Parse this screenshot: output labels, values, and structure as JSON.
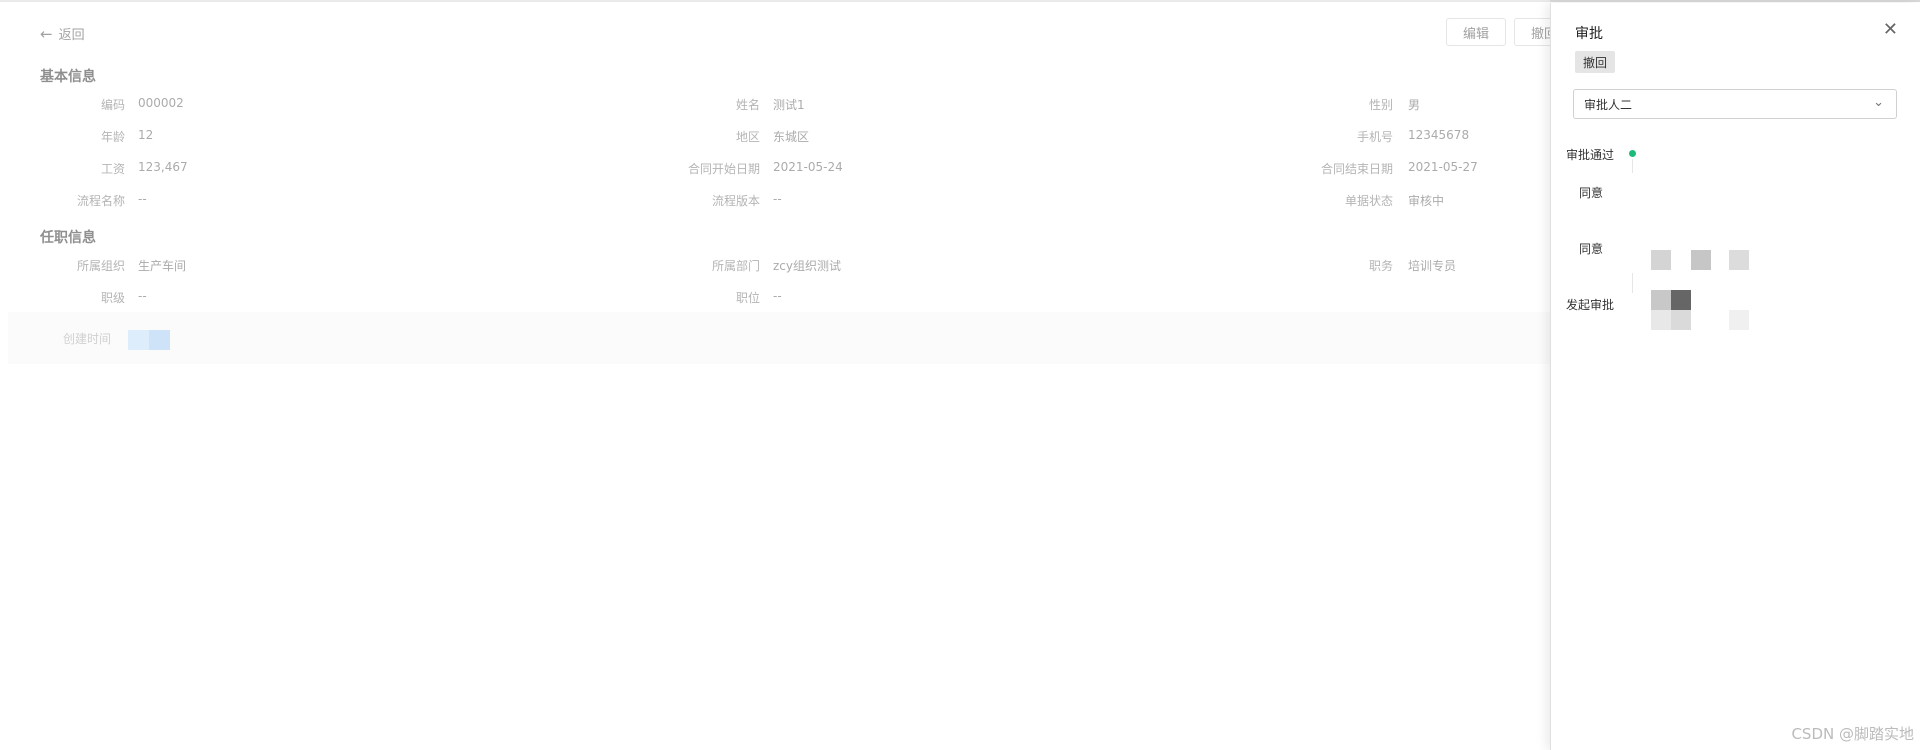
{
  "header": {
    "back_label": "返回",
    "edit_label": "编辑",
    "revoke_label": "撤回"
  },
  "basic_info": {
    "title": "基本信息",
    "fields": [
      {
        "label": "编码",
        "value": "000002"
      },
      {
        "label": "姓名",
        "value": "测试1"
      },
      {
        "label": "性别",
        "value": "男"
      },
      {
        "label": "年龄",
        "value": "12"
      },
      {
        "label": "地区",
        "value": "东城区"
      },
      {
        "label": "手机号",
        "value": "12345678"
      },
      {
        "label": "工资",
        "value": "123,467"
      },
      {
        "label": "合同开始日期",
        "value": "2021-05-24"
      },
      {
        "label": "合同结束日期",
        "value": "2021-05-27"
      },
      {
        "label": "流程名称",
        "value": "--"
      },
      {
        "label": "流程版本",
        "value": "--"
      },
      {
        "label": "单据状态",
        "value": "审核中"
      }
    ]
  },
  "job_info": {
    "title": "任职信息",
    "fields": [
      {
        "label": "所属组织",
        "value": "生产车间"
      },
      {
        "label": "所属部门",
        "value": "zcy组织测试"
      },
      {
        "label": "职务",
        "value": "培训专员"
      },
      {
        "label": "职级",
        "value": "--"
      },
      {
        "label": "职位",
        "value": "--"
      }
    ]
  },
  "created": {
    "label": "创建时间"
  },
  "drawer": {
    "title": "审批",
    "revoke_tag": "撤回",
    "approver_select": "审批人二",
    "timeline": {
      "status": "审批通过",
      "step1": "同意",
      "step2": "同意",
      "initiate": "发起审批"
    }
  },
  "watermark": "CSDN @脚踏实地"
}
